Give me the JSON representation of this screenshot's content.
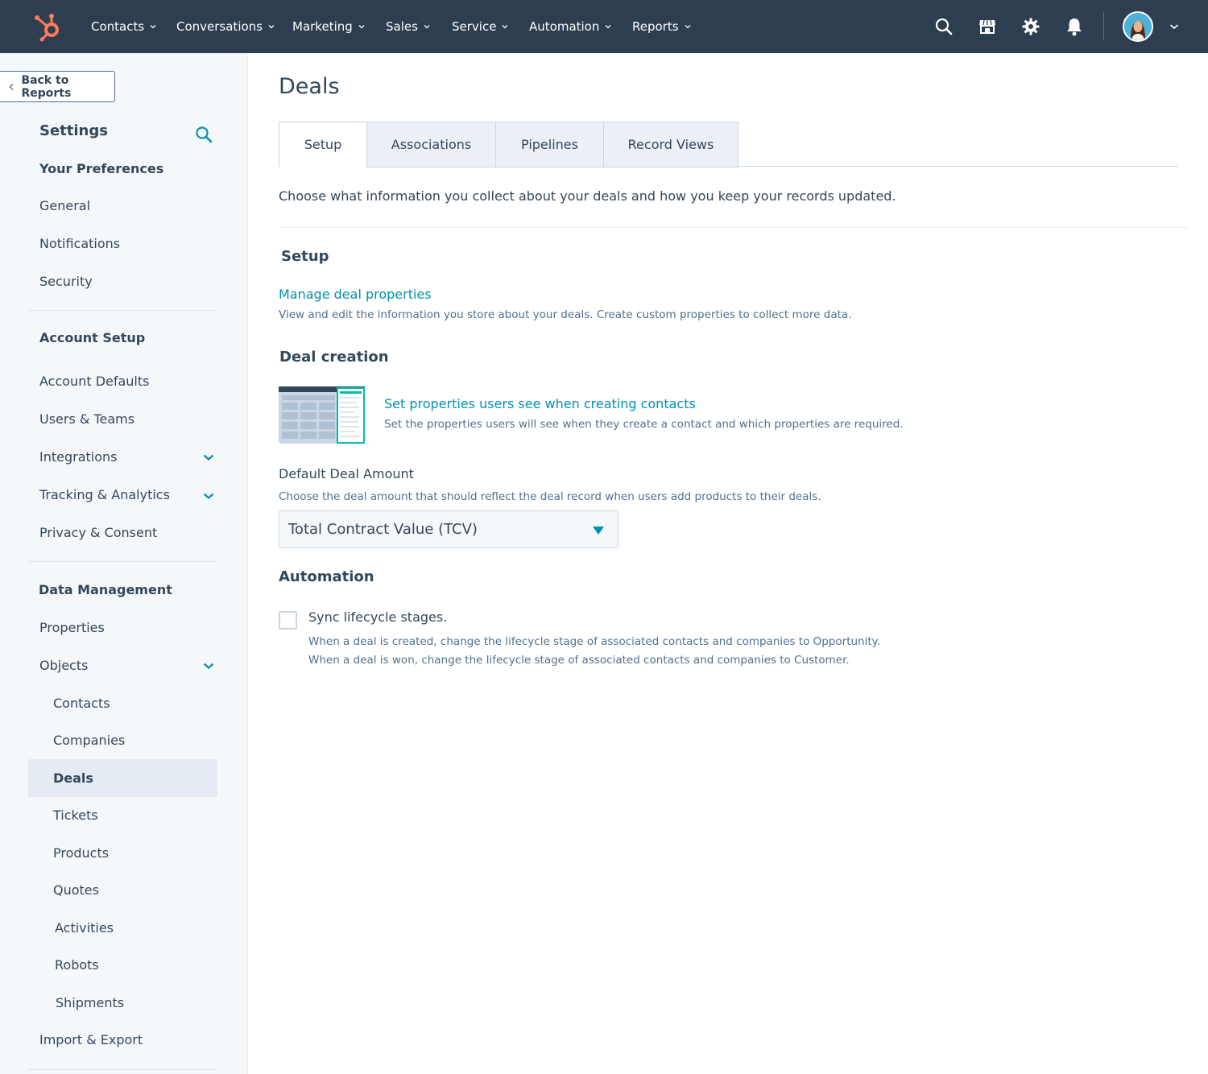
{
  "topnav": {
    "items": [
      {
        "label": "Contacts"
      },
      {
        "label": "Conversations"
      },
      {
        "label": "Marketing"
      },
      {
        "label": "Sales"
      },
      {
        "label": "Service"
      },
      {
        "label": "Automation"
      },
      {
        "label": "Reports"
      }
    ],
    "icons": [
      "search-icon",
      "marketplace-icon",
      "gear-icon",
      "bell-icon"
    ],
    "brand_color": "#2d3e50",
    "logo_color": "#ff7a59"
  },
  "sidebar": {
    "back_label": "Back to Reports",
    "title": "Settings",
    "sections": [
      {
        "heading": "Your Preferences",
        "items": [
          "General",
          "Notifications",
          "Security"
        ]
      },
      {
        "heading": "Account Setup",
        "items": [
          "Account Defaults",
          "Users & Teams",
          "Integrations",
          "Tracking & Analytics",
          "Privacy & Consent"
        ]
      },
      {
        "heading": "Data Management",
        "items": [
          "Properties",
          "Objects"
        ],
        "objects": [
          "Contacts",
          "Companies",
          "Deals",
          "Tickets",
          "Products",
          "Quotes",
          "Activities",
          "Robots",
          "Shipments"
        ],
        "after": [
          "Import & Export"
        ]
      }
    ],
    "active_item": "Deals"
  },
  "main": {
    "title": "Deals",
    "tabs": [
      {
        "label": "Setup",
        "active": true
      },
      {
        "label": "Associations",
        "active": false
      },
      {
        "label": "Pipelines",
        "active": false
      },
      {
        "label": "Record Views",
        "active": false
      }
    ],
    "intro": "Choose what information you collect about your deals and how you keep your records updated.",
    "setup": {
      "heading": "Setup",
      "link": "Manage deal properties",
      "description": "View and edit the information you store about your deals. Create custom properties to collect more data."
    },
    "deal_creation": {
      "heading": "Deal creation",
      "link": "Set properties users see when creating contacts",
      "description": "Set the properties users will see when they create a contact and which properties are required."
    },
    "default_amount": {
      "label": "Default Deal Amount",
      "description": "Choose the deal amount that should reflect the deal record when users add products to their deals.",
      "selected": "Total Contract Value (TCV)"
    },
    "automation": {
      "heading": "Automation",
      "checkbox_label": "Sync lifecycle stages.",
      "checked": false,
      "description": "When a deal is created, change the lifecycle stage of associated contacts and companies to Opportunity. When a deal is won, change the lifecycle stage of associated contacts and companies to Customer."
    },
    "link_color": "#0091ae"
  }
}
